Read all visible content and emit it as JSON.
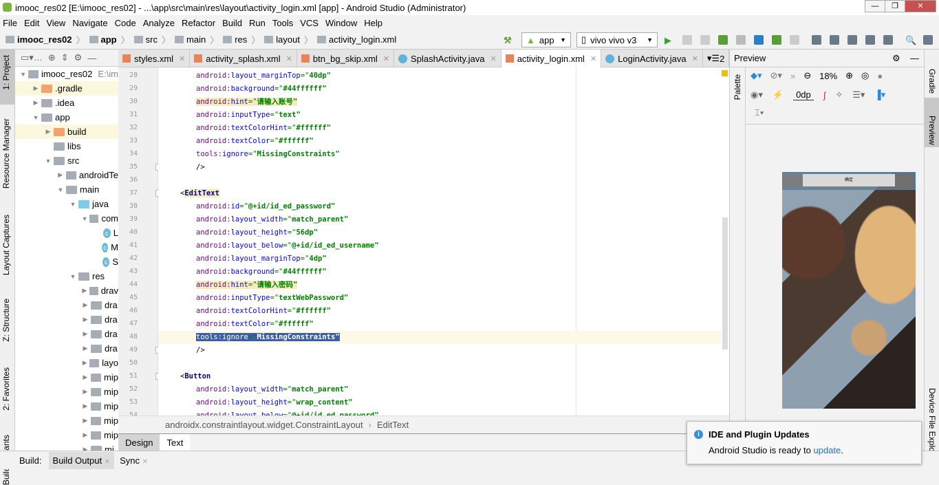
{
  "window": {
    "title": "imooc_res02 [E:\\imooc_res02] - ...\\app\\src\\main\\res\\layout\\activity_login.xml [app] - Android Studio (Administrator)"
  },
  "menu": [
    "File",
    "Edit",
    "View",
    "Navigate",
    "Code",
    "Analyze",
    "Refactor",
    "Build",
    "Run",
    "Tools",
    "VCS",
    "Window",
    "Help"
  ],
  "breadcrumb": [
    "imooc_res02",
    "app",
    "src",
    "main",
    "res",
    "layout",
    "activity_login.xml"
  ],
  "toolbar": {
    "run_config": "app",
    "device": "vivo vivo v3"
  },
  "left_strip": [
    "1: Project",
    "Resource Manager",
    "Layout Captures",
    "Z: Structure",
    "2: Favorites",
    "Build Variants"
  ],
  "project": {
    "root_path": "E:\\im",
    "items": [
      {
        "label": "imooc_res02",
        "level": 0,
        "expanded": true,
        "icon": "module"
      },
      {
        "label": ".gradle",
        "level": 1,
        "expanded": false,
        "icon": "folder-orange",
        "hl": true
      },
      {
        "label": ".idea",
        "level": 1,
        "expanded": false,
        "icon": "folder"
      },
      {
        "label": "app",
        "level": 1,
        "expanded": true,
        "icon": "module"
      },
      {
        "label": "build",
        "level": 2,
        "expanded": false,
        "icon": "folder-orange",
        "hl": true
      },
      {
        "label": "libs",
        "level": 2,
        "icon": "folder"
      },
      {
        "label": "src",
        "level": 2,
        "expanded": true,
        "icon": "folder"
      },
      {
        "label": "androidTe",
        "level": 3,
        "expanded": false,
        "icon": "folder"
      },
      {
        "label": "main",
        "level": 3,
        "expanded": true,
        "icon": "folder"
      },
      {
        "label": "java",
        "level": 4,
        "expanded": true,
        "icon": "folder-blue"
      },
      {
        "label": "com",
        "level": 5,
        "expanded": true,
        "icon": "package"
      },
      {
        "label": "L",
        "level": 6,
        "icon": "class"
      },
      {
        "label": "M",
        "level": 6,
        "icon": "class"
      },
      {
        "label": "S",
        "level": 6,
        "icon": "class"
      },
      {
        "label": "res",
        "level": 4,
        "expanded": true,
        "icon": "folder"
      },
      {
        "label": "drav",
        "level": 5,
        "expanded": false,
        "icon": "folder"
      },
      {
        "label": "dra",
        "level": 5,
        "expanded": false,
        "icon": "folder"
      },
      {
        "label": "dra",
        "level": 5,
        "expanded": false,
        "icon": "folder"
      },
      {
        "label": "dra",
        "level": 5,
        "expanded": false,
        "icon": "folder"
      },
      {
        "label": "dra",
        "level": 5,
        "expanded": false,
        "icon": "folder"
      },
      {
        "label": "layo",
        "level": 5,
        "expanded": false,
        "icon": "folder"
      },
      {
        "label": "mip",
        "level": 5,
        "expanded": false,
        "icon": "folder"
      },
      {
        "label": "mip",
        "level": 5,
        "expanded": false,
        "icon": "folder"
      },
      {
        "label": "mip",
        "level": 5,
        "expanded": false,
        "icon": "folder"
      },
      {
        "label": "mip",
        "level": 5,
        "expanded": false,
        "icon": "folder"
      },
      {
        "label": "mip",
        "level": 5,
        "expanded": false,
        "icon": "folder"
      },
      {
        "label": "mi",
        "level": 5,
        "expanded": false,
        "icon": "folder"
      }
    ]
  },
  "tabs": [
    {
      "label": "styles.xml",
      "type": "xml"
    },
    {
      "label": "activity_splash.xml",
      "type": "xml"
    },
    {
      "label": "btn_bg_skip.xml",
      "type": "xml"
    },
    {
      "label": "SplashActivity.java",
      "type": "java"
    },
    {
      "label": "activity_login.xml",
      "type": "xml",
      "active": true
    },
    {
      "label": "LoginActivity.java",
      "type": "java"
    }
  ],
  "tabs_overflow": "2",
  "code": [
    {
      "n": 28,
      "ns": "android",
      "attr": "layout_marginTop",
      "val": "40dp"
    },
    {
      "n": 29,
      "ns": "android",
      "attr": "background",
      "val": "#44ffffff"
    },
    {
      "n": 30,
      "ns": "android",
      "attr": "hint",
      "val": "请输入账号",
      "hl": true
    },
    {
      "n": 31,
      "ns": "android",
      "attr": "inputType",
      "val": "text"
    },
    {
      "n": 32,
      "ns": "android",
      "attr": "textColorHint",
      "val": "#ffffff"
    },
    {
      "n": 33,
      "ns": "android",
      "attr": "textColor",
      "val": "#ffffff"
    },
    {
      "n": 34,
      "ns": "tools",
      "attr": "ignore",
      "val": "MissingConstraints"
    },
    {
      "n": 35,
      "close": "/>"
    },
    {
      "n": 36
    },
    {
      "n": 37,
      "tag": "EditText"
    },
    {
      "n": 38,
      "ns": "android",
      "attr": "id",
      "val": "@+id/id_ed_password"
    },
    {
      "n": 39,
      "ns": "android",
      "attr": "layout_width",
      "val": "match_parent"
    },
    {
      "n": 40,
      "ns": "android",
      "attr": "layout_height",
      "val": "56dp"
    },
    {
      "n": 41,
      "ns": "android",
      "attr": "layout_below",
      "val": "@+id/id_ed_username"
    },
    {
      "n": 42,
      "ns": "android",
      "attr": "layout_marginTop",
      "val": "4dp"
    },
    {
      "n": 43,
      "ns": "android",
      "attr": "background",
      "val": "#44ffffff"
    },
    {
      "n": 44,
      "ns": "android",
      "attr": "hint",
      "val": "请输入密码",
      "hl": true
    },
    {
      "n": 45,
      "ns": "android",
      "attr": "inputType",
      "val": "textWebPassword"
    },
    {
      "n": 46,
      "ns": "android",
      "attr": "textColorHint",
      "val": "#ffffff"
    },
    {
      "n": 47,
      "ns": "android",
      "attr": "textColor",
      "val": "#ffffff"
    },
    {
      "n": 48,
      "ns": "tools",
      "attr": "ignore",
      "val": "MissingConstraints",
      "selected": true,
      "current": true
    },
    {
      "n": 49,
      "close": "/>"
    },
    {
      "n": 50
    },
    {
      "n": 51,
      "tag": "Button"
    },
    {
      "n": 52,
      "ns": "android",
      "attr": "layout_width",
      "val": "match_parent"
    },
    {
      "n": 53,
      "ns": "android",
      "attr": "layout_height",
      "val": "wrap_content"
    },
    {
      "n": 54,
      "ns": "android",
      "attr": "layout_below",
      "val": "@+id/id_ed_password"
    }
  ],
  "editor_breadcrumb": [
    "androidx.constraintlayout.widget.ConstraintLayout",
    "EditText"
  ],
  "editor_mode_tabs": [
    {
      "label": "Design"
    },
    {
      "label": "Text",
      "active": true
    }
  ],
  "preview": {
    "title": "Preview",
    "palette_label": "Palette",
    "zoom": "18%",
    "margin": "0dp",
    "button_text": "确定"
  },
  "right_strip": [
    "Gradle",
    "Preview",
    "Device File Explorer"
  ],
  "build_bar": {
    "label": "Build:",
    "tabs": [
      "Build Output",
      "Sync"
    ]
  },
  "notification": {
    "title": "IDE and Plugin Updates",
    "text": "Android Studio is ready to ",
    "link": "update",
    "suffix": "."
  },
  "colors": {
    "selection": "#3d5ea4",
    "tag": "#000080",
    "value": "#008000",
    "namespace": "#660e7a",
    "link": "#2470b3"
  }
}
